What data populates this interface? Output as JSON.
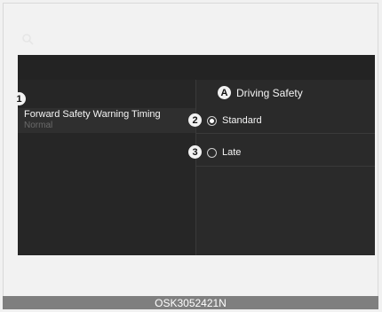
{
  "panel": {
    "title": "Driving Safety"
  },
  "setting": {
    "name": "Forward Safety Warning Timing",
    "value": "Normal"
  },
  "options": [
    {
      "label": "Standard",
      "selected": true
    },
    {
      "label": "Late",
      "selected": false
    }
  ],
  "callouts": {
    "a": "A",
    "one": "1",
    "two": "2",
    "three": "3"
  },
  "footer": {
    "code": "OSK3052421N"
  }
}
